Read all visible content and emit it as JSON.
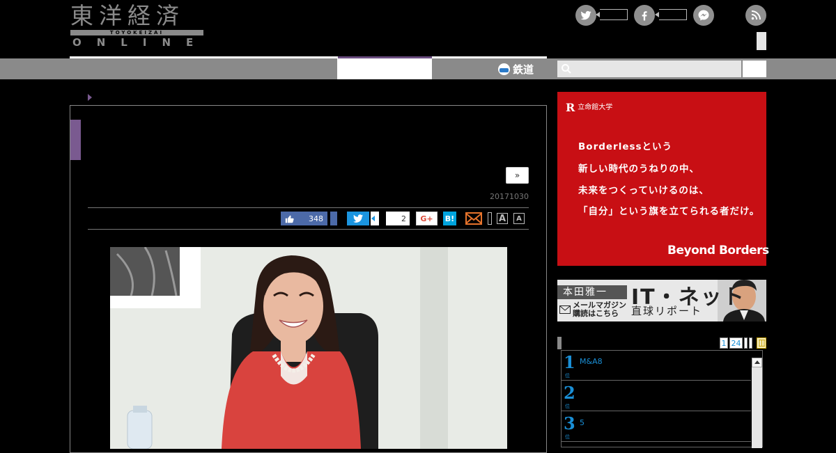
{
  "header": {
    "logo_kanji": "東洋経済",
    "logo_roman": "TOYOKEIZAI",
    "logo_online": "ONLINE"
  },
  "social": {
    "icons": [
      "twitter-icon",
      "facebook-icon",
      "messenger-icon",
      "rss-icon"
    ]
  },
  "nav": {
    "rail_label": "鉄道"
  },
  "article": {
    "next_label": "»",
    "date": "20171030",
    "fb_like_count": "348",
    "g_count": "2",
    "gplus_label": "G+",
    "hatena_label": "B!",
    "font_large": "A",
    "font_small": "A"
  },
  "ad": {
    "logo_r": "R",
    "logo_name": "立命館大学",
    "line1": "Borderlessという",
    "line2": "新しい時代のうねりの中、",
    "line3": "未来をつくっていけるのは、",
    "line4": "「自分」という旗を立てられる者だけ。",
    "tagline": "Beyond Borders"
  },
  "banner": {
    "name": "本田雅一",
    "title": "IT・ネット",
    "subtitle": "直球リポート",
    "mag1": "メールマガジン",
    "mag2": "購読はこちら"
  },
  "ranking": {
    "tabs": [
      "1",
      "24"
    ],
    "items": [
      {
        "rank": "1",
        "text": "M&A8"
      },
      {
        "rank": "2",
        "text": ""
      },
      {
        "rank": "3",
        "text": "5"
      }
    ]
  },
  "colors": {
    "accent_purple": "#7a5a90",
    "ad_red": "#c80f14",
    "rank_blue": "#1a8fd6",
    "nav_gray": "#8a8a8a"
  }
}
